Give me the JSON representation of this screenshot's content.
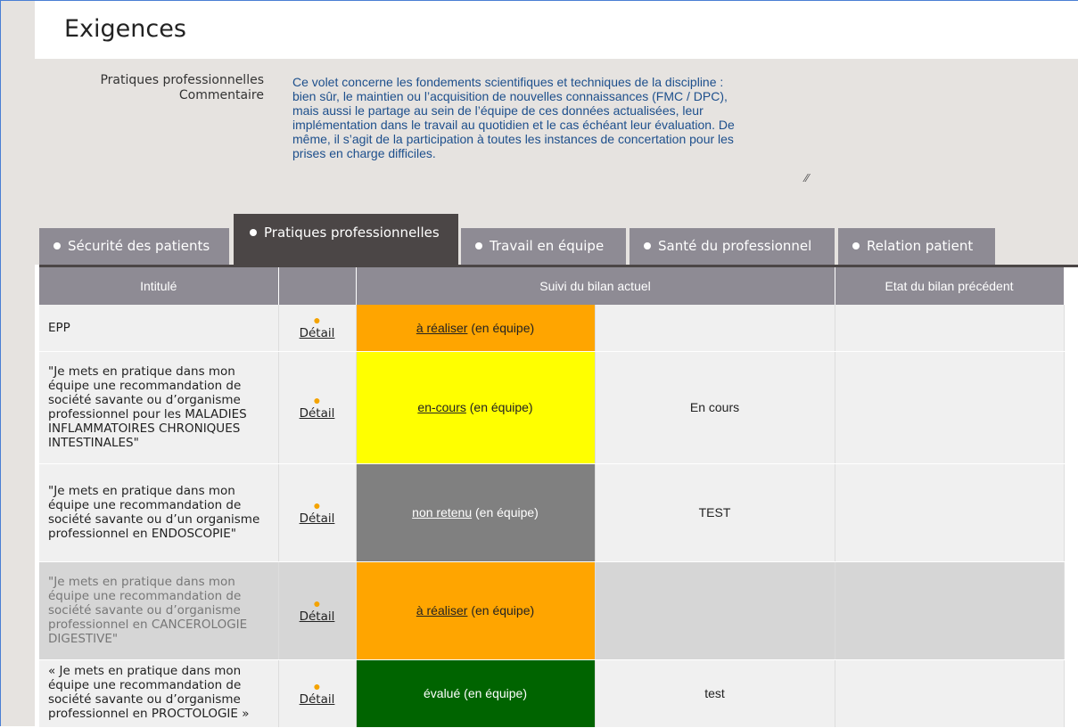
{
  "page": {
    "title": "Exigences"
  },
  "description": {
    "label_line1": "Pratiques professionnelles",
    "label_line2": "Commentaire",
    "text": "Ce volet concerne les fondements scientifiques et techniques de la discipline :\n bien sûr, le maintien ou l’acquisition de nouvelles connaissances (FMC / DPC),\n mais aussi le partage au sein de l’équipe de ces données actualisées, leur\nimplémentation dans le travail au quotidien et le cas échéant leur évaluation. De\nmême, il s’agit de la participation à toutes les instances de concertation pour les\nprises en charge difficiles."
  },
  "tabs": [
    {
      "label": "Sécurité des patients",
      "active": false
    },
    {
      "label": "Pratiques professionnelles",
      "active": true
    },
    {
      "label": "Travail en équipe",
      "active": false
    },
    {
      "label": "Santé du professionnel",
      "active": false
    },
    {
      "label": "Relation patient",
      "active": false
    }
  ],
  "table": {
    "headers": [
      "Intitulé",
      "",
      "Suivi du bilan actuel",
      "Etat du bilan précédent"
    ],
    "detail_label": "Détail",
    "rows": [
      {
        "intitule": "EPP",
        "status_link": "à réaliser",
        "status_suffix": " (en équipe)",
        "status_color": "#ffa500",
        "status_text_color": "#222222",
        "suivi": "",
        "etat": ""
      },
      {
        "intitule": "\"Je mets en pratique dans mon équipe une recommandation de société savante ou d’organisme professionnel pour les MALADIES INFLAMMATOIRES CHRONIQUES INTESTINALES\"",
        "status_link": "en-cours",
        "status_suffix": " (en équipe)",
        "status_color": "#ffff00",
        "status_text_color": "#222222",
        "suivi": "En cours",
        "etat": ""
      },
      {
        "intitule": "\"Je mets en pratique dans mon équipe une recommandation de société savante ou d’un organisme professionnel en ENDOSCOPIE\"",
        "status_link": "non retenu",
        "status_suffix": " (en équipe)",
        "status_color": "#808080",
        "status_text_color": "#ffffff",
        "suivi": "TEST",
        "etat": ""
      },
      {
        "intitule": "\"Je mets en pratique dans mon équipe une recommandation de société savante ou d’organisme professionnel en CANCEROLOGIE DIGESTIVE\"",
        "status_link": "à réaliser",
        "status_suffix": " (en équipe)",
        "status_color": "#ffa500",
        "status_text_color": "#222222",
        "suivi": "",
        "etat": "",
        "dimmed": true
      },
      {
        "intitule": "« Je mets en pratique dans mon équipe une recommandation de société savante ou d’organisme professionnel en PROCTOLOGIE »",
        "status_link": "évalué",
        "status_suffix": " (en équipe)",
        "status_color": "#006400",
        "status_text_color": "#ffffff",
        "suivi": "test",
        "etat": ""
      }
    ]
  }
}
